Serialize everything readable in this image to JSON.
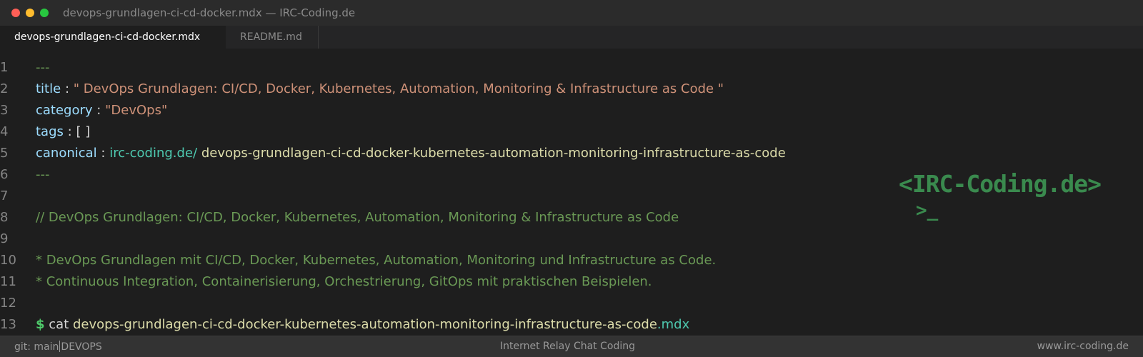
{
  "window": {
    "title": "devops-grundlagen-ci-cd-docker.mdx — IRC-Coding.de"
  },
  "tabs": [
    {
      "label": "devops-grundlagen-ci-cd-docker.mdx",
      "active": true
    },
    {
      "label": "README.md",
      "active": false
    }
  ],
  "editor": {
    "line_numbers": [
      "1",
      "2",
      "3",
      "4",
      "5",
      "6",
      "7",
      "8",
      "9",
      "10",
      "11",
      "12",
      "13"
    ],
    "fm_delim": "---",
    "title_key": "title",
    "title_value": "\" DevOps Grundlagen: CI/CD, Docker, Kubernetes, Automation, Monitoring & Infrastructure as Code \"",
    "category_key": "category",
    "category_value": "\"DevOps\"",
    "tags_key": "tags",
    "tags_value": "[ ]",
    "canonical_key": "canonical",
    "canonical_domain": "irc-coding.de/",
    "canonical_slug": "devops-grundlagen-ci-cd-docker-kubernetes-automation-monitoring-infrastructure-as-code",
    "colon": ":",
    "comment": "// DevOps Grundlagen: CI/CD, Docker, Kubernetes, Automation, Monitoring & Infrastructure as Code",
    "bullet_1": "* DevOps Grundlagen mit CI/CD, Docker, Kubernetes, Automation, Monitoring und Infrastructure as Code.",
    "bullet_2": "* Continuous Integration, Containerisierung, Orchestrierung, GitOps mit praktischen Beispielen.",
    "prompt": "$",
    "cmd": "cat",
    "cmd_file": "devops-grundlagen-ci-cd-docker-kubernetes-automation-monitoring-infrastructure-as-code",
    "cmd_ext": ".mdx"
  },
  "logo": {
    "text": "<IRC-Coding.de>",
    "cursor": ">_"
  },
  "statusbar": {
    "branch": "git: main",
    "project": "DEVOPS",
    "center": "Internet Relay Chat Coding",
    "right": "www.irc-coding.de"
  },
  "colors": {
    "background": "#1e1e1e",
    "frontmatter": "#6a9955",
    "key": "#9cdcfe",
    "string": "#ce9178",
    "teal": "#4ec9b0",
    "logo": "#3a8a4e"
  }
}
